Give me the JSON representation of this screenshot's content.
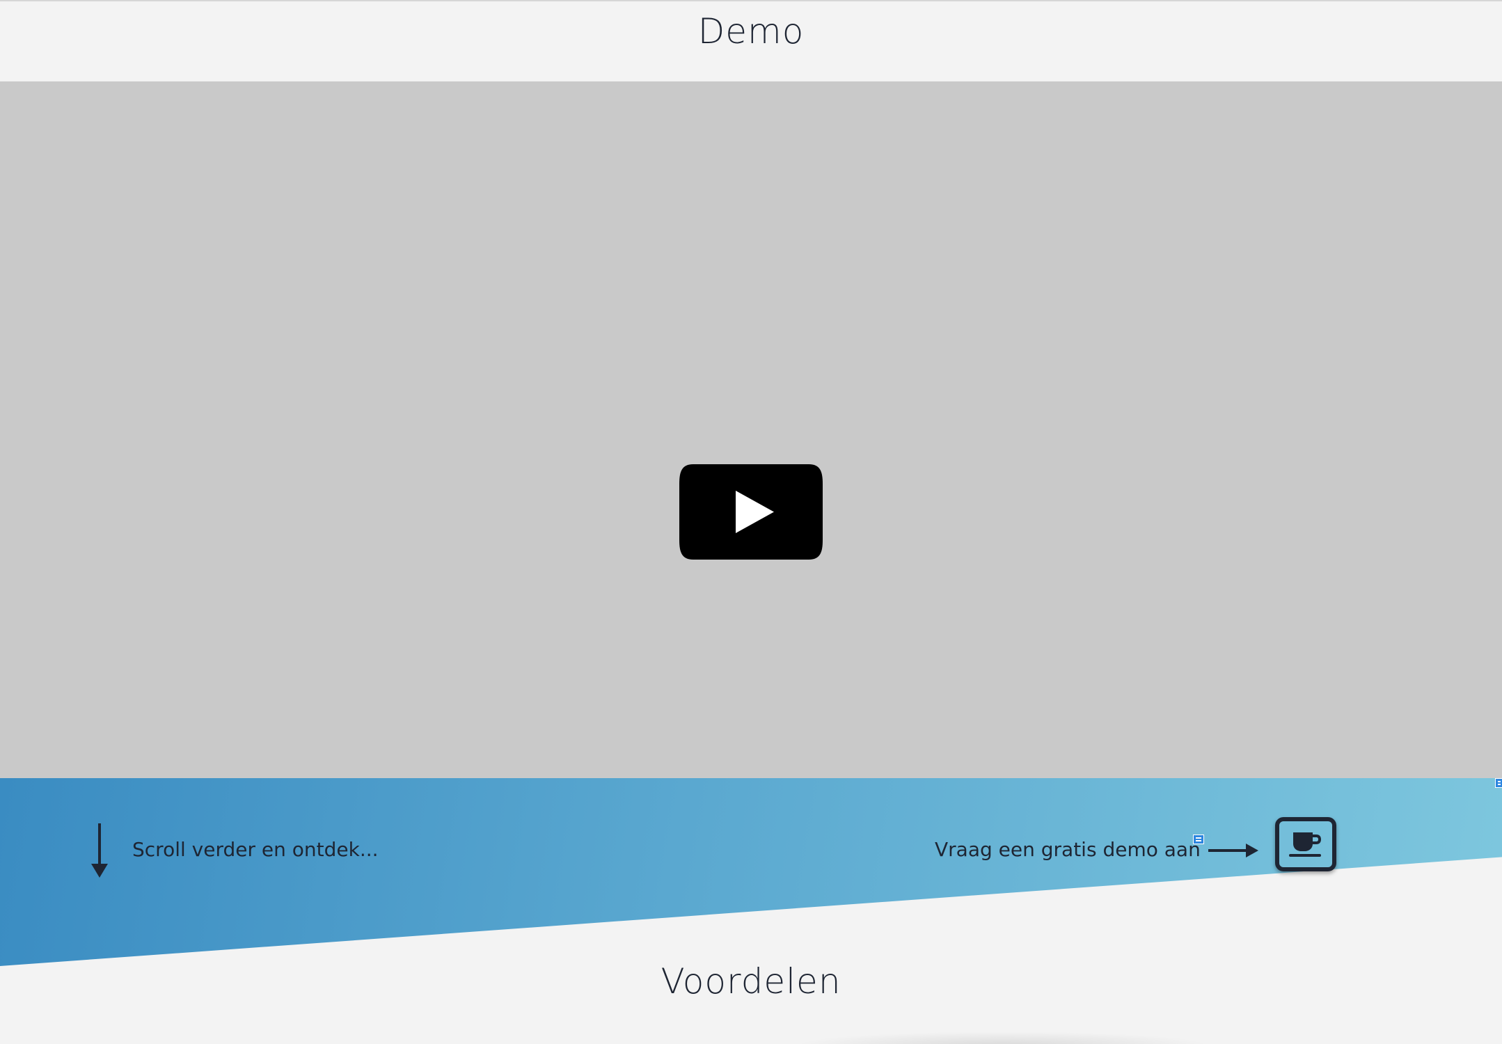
{
  "header": {
    "title": "Demo"
  },
  "video": {
    "play_icon": "youtube-play-icon"
  },
  "banner": {
    "scroll_text": "Scroll verder en ontdek...",
    "demo_link_text": "Vraag een gratis demo aan",
    "icons": {
      "scroll": "arrow-down-icon",
      "pointer": "arrow-right-icon",
      "cta": "coffee-cup-icon"
    },
    "gradient": [
      "#3a8cc2",
      "#7ec7de"
    ]
  },
  "sections": {
    "benefits_title": "Voordelen"
  },
  "colors": {
    "text": "#1e2533",
    "background": "#f3f3f3",
    "video_placeholder": "#c9c9c9"
  }
}
